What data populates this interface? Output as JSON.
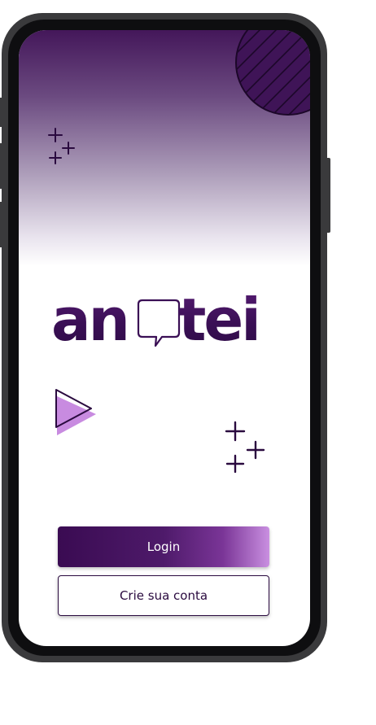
{
  "app": {
    "logo_text_left": "an",
    "logo_text_right": "tei",
    "logo_full": "anotei"
  },
  "actions": {
    "login_label": "Login",
    "register_label": "Crie sua conta"
  },
  "colors": {
    "brand_dark": "#3a0b52",
    "brand_mid": "#6b4a80",
    "brand_light": "#c98fe0",
    "outline": "#2a0a3f",
    "phone_frame": "#3a3a3c"
  },
  "icons": {
    "top_decoration": "hatched-circle-icon",
    "sparkles": "sparkles-icon",
    "play": "play-triangle-icon",
    "logo_bubble": "speech-bubble-icon"
  }
}
